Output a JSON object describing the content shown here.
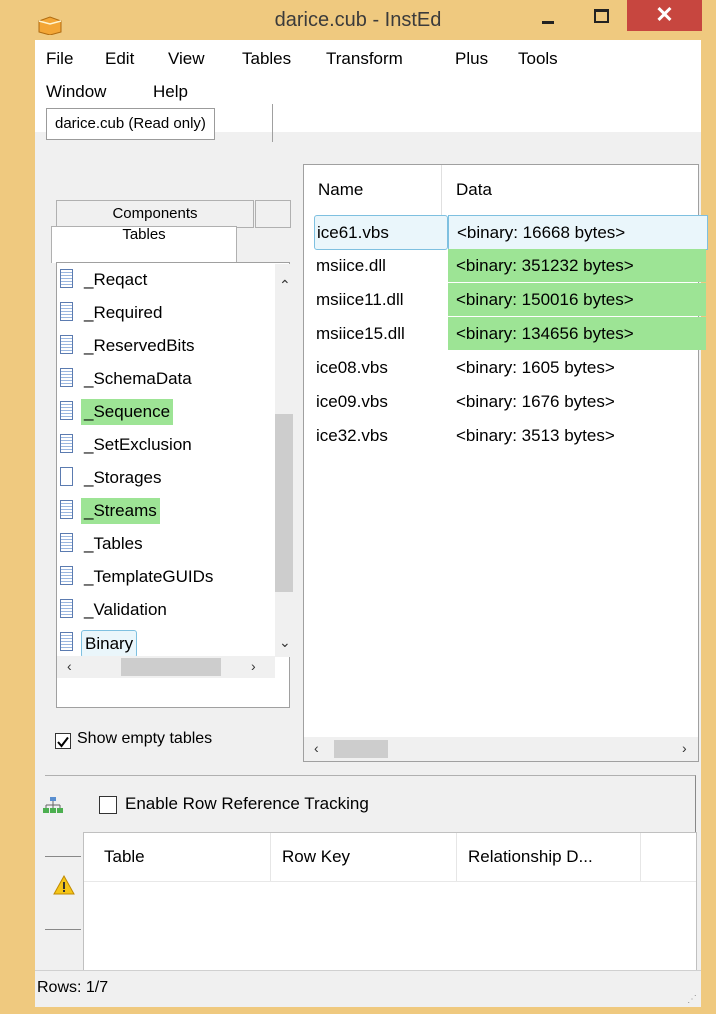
{
  "window": {
    "title": "darice.cub - InstEd",
    "close_glyph": "✕",
    "colors": {
      "frame": "#efc97f",
      "close": "#c7463f",
      "highlight": "#9de495",
      "selection": "#7ec0e0"
    }
  },
  "menu": {
    "items": [
      "File",
      "Edit",
      "View",
      "Tables",
      "Transform",
      "Plus",
      "Tools",
      "Window",
      "Help"
    ]
  },
  "doc_tab": "darice.cub (Read only)",
  "left_tabs": {
    "components": "Components",
    "tables": "Tables"
  },
  "tables_list": [
    {
      "label": "_Reqact",
      "highlight": false
    },
    {
      "label": "_Required",
      "highlight": false
    },
    {
      "label": "_ReservedBits",
      "highlight": false
    },
    {
      "label": "_SchemaData",
      "highlight": false
    },
    {
      "label": "_Sequence",
      "highlight": true
    },
    {
      "label": "_SetExclusion",
      "highlight": false
    },
    {
      "label": "_Storages",
      "highlight": false
    },
    {
      "label": "_Streams",
      "highlight": true
    },
    {
      "label": "_Tables",
      "highlight": false
    },
    {
      "label": "_TemplateGUIDs",
      "highlight": false
    },
    {
      "label": "_Validation",
      "highlight": false
    },
    {
      "label": "Binary",
      "highlight": false,
      "selected": true
    }
  ],
  "show_empty": {
    "label": "Show empty tables",
    "checked": true
  },
  "grid": {
    "columns": [
      "Name",
      "Data"
    ],
    "rows": [
      {
        "name": "ice61.vbs",
        "data": "<binary: 16668 bytes>",
        "highlight": false,
        "selected": true
      },
      {
        "name": "msiice.dll",
        "data": "<binary: 351232 bytes>",
        "highlight": true
      },
      {
        "name": "msiice11.dll",
        "data": "<binary: 150016 bytes>",
        "highlight": true
      },
      {
        "name": "msiice15.dll",
        "data": "<binary: 134656 bytes>",
        "highlight": true
      },
      {
        "name": "ice08.vbs",
        "data": "<binary: 1605 bytes>",
        "highlight": false
      },
      {
        "name": "ice09.vbs",
        "data": "<binary: 1676 bytes>",
        "highlight": false
      },
      {
        "name": "ice32.vbs",
        "data": "<binary: 3513 bytes>",
        "highlight": false
      }
    ]
  },
  "ref_tracking": {
    "checkbox_label": "Enable Row Reference Tracking",
    "checked": false,
    "columns": [
      "Table",
      "Row Key",
      "Relationship D..."
    ]
  },
  "status": {
    "rows": "Rows: 1/7"
  }
}
